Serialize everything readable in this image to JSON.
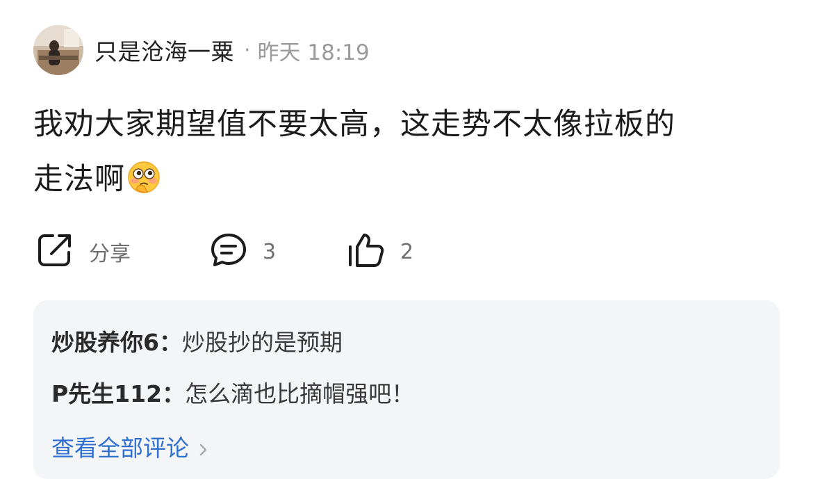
{
  "header": {
    "username": "只是沧海一粟",
    "separator": "·",
    "time": "昨天 18:19"
  },
  "post": {
    "text_line1": "我劝大家期望值不要太高，这走势不太像拉板的",
    "text_line2": "走法啊",
    "emoji_icon": "flushed-thinking-emoji"
  },
  "actions": {
    "share_label": "分享",
    "comment_count": "3",
    "like_count": "2"
  },
  "comments": {
    "items": [
      {
        "author": "炒股养你6",
        "separator": "：",
        "text": "炒股抄的是预期"
      },
      {
        "author": "P先生112",
        "separator": "：",
        "text": "怎么滴也比摘帽强吧！"
      }
    ],
    "view_all_label": "查看全部评论"
  },
  "colors": {
    "link": "#2f6fd0",
    "muted": "#9a9a9a",
    "panel_bg": "#f4f5f7"
  }
}
